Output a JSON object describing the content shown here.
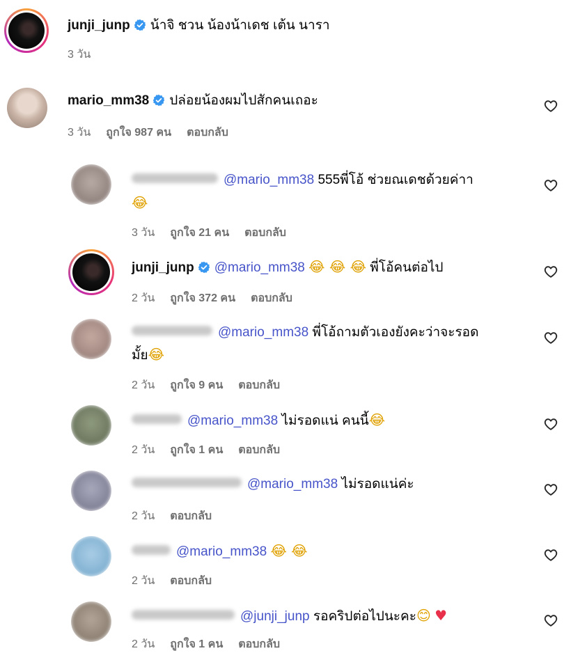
{
  "comments": [
    {
      "username": "junji_junp",
      "text": "น้าจิ ชวน น้องน้าเดช เต้น นารา",
      "time": "3 วัน"
    },
    {
      "username": "mario_mm38",
      "text": "ปล่อยน้องผมไปสักคนเถอะ",
      "time": "3 วัน",
      "likes": "ถูกใจ 987 คน",
      "reply": "ตอบกลับ"
    },
    {
      "mention": "@mario_mm38",
      "text": "555พี่โอ้ ช่วยณเดชด้วยค่าา",
      "emoji": "😂",
      "time": "3 วัน",
      "likes": "ถูกใจ 21 คน",
      "reply": "ตอบกลับ"
    },
    {
      "username": "junji_junp",
      "mention": "@mario_mm38",
      "emoji": "😂 😂 😂",
      "text": "พี่โอ้คนต่อไป",
      "time": "2 วัน",
      "likes": "ถูกใจ 372 คน",
      "reply": "ตอบกลับ"
    },
    {
      "mention": "@mario_mm38",
      "text": "พี่โอ้ถามตัวเองยังคะว่าจะรอด",
      "text2": "มั้ย",
      "emoji": "😂",
      "time": "2 วัน",
      "likes": "ถูกใจ 9 คน",
      "reply": "ตอบกลับ"
    },
    {
      "mention": "@mario_mm38",
      "text": "ไม่รอดแน่ คนนี้",
      "emoji": "😂",
      "time": "2 วัน",
      "likes": "ถูกใจ 1 คน",
      "reply": "ตอบกลับ"
    },
    {
      "mention": "@mario_mm38",
      "text": "ไม่รอดแน่ค่ะ",
      "time": "2 วัน",
      "reply": "ตอบกลับ"
    },
    {
      "mention": "@mario_mm38",
      "emoji": "😂 😂",
      "time": "2 วัน",
      "reply": "ตอบกลับ"
    },
    {
      "mention": "@junji_junp",
      "text": "รอคริปต่อไปนะคะ",
      "emoji": "😊",
      "heart": "♥",
      "time": "2 วัน",
      "likes": "ถูกใจ 1 คน",
      "reply": "ตอบกลับ"
    }
  ],
  "icons": {
    "verified": "verified-badge-icon",
    "like": "heart-outline-icon"
  },
  "colors": {
    "mention": "#4754c9",
    "meta": "#6f6f6f",
    "verified": "#3897f0"
  }
}
